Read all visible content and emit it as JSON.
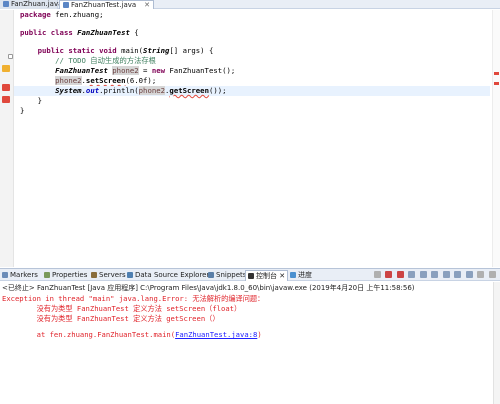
{
  "editor_tabs": [
    {
      "label": "FanZhuan.java",
      "active": false
    },
    {
      "label": "FanZhuanTest.java",
      "active": true
    }
  ],
  "code": {
    "package_kw": "package",
    "package_name": " fen.zhuang;",
    "line_public": "public",
    "line_class": "class",
    "class_name": "FanZhuanTest",
    "brace_open": " {",
    "main_sig_1": "public",
    "main_sig_2": "static",
    "main_sig_3": "void",
    "main_sig_rest": " main(",
    "main_string": "String",
    "main_args": "[] args) {",
    "todo_comment": "// TODO 自动生成的方法存根",
    "decl_type": "FanZhuanTest",
    "decl_var": "phone2",
    "decl_eq": " = ",
    "decl_new": "new",
    "decl_ctor": " FanZhuanTest();",
    "call1_var": "phone2",
    "call1_dot": ".",
    "call1_method": "setScreen",
    "call1_args": "(6.0f);",
    "call2_system": "System",
    "call2_dot": ".",
    "call2_out": "out",
    "call2_print": ".println(",
    "call2_var": "phone2",
    "call2_dot2": ".",
    "call2_method": "getScreen",
    "call2_end": "());",
    "close_inner": "}",
    "close_outer": "}"
  },
  "bottom_tabs": [
    {
      "label": "Markers",
      "color": "#6b8cb8"
    },
    {
      "label": "Properties",
      "color": "#7a9a5a"
    },
    {
      "label": "Servers",
      "color": "#8a6d3b"
    },
    {
      "label": "Data Source Explorer",
      "color": "#4f7fb0"
    },
    {
      "label": "Snippets",
      "color": "#5a7fa8"
    },
    {
      "label": "控制台",
      "color": "#333333",
      "active": true,
      "close": "✕"
    },
    {
      "label": "进度",
      "color": "#4a90d0"
    }
  ],
  "console": {
    "info": "<已终止> FanZhuanTest [Java 应用程序] C:\\Program Files\\Java\\jdk1.8.0_60\\bin\\javaw.exe  (2019年4月20日 上午11:58:56)",
    "line1": "Exception in thread \"main\" java.lang.Error: 无法解析的编译问题：",
    "line2": "        没有为类型 FanZhuanTest 定义方法 setScreen（float）",
    "line3": "        没有为类型 FanZhuanTest 定义方法 getScreen（）",
    "line4_prefix": "        at fen.zhuang.FanZhuanTest.main(",
    "line4_link": "FanZhuanTest.java:8",
    "line4_suffix": ")"
  }
}
